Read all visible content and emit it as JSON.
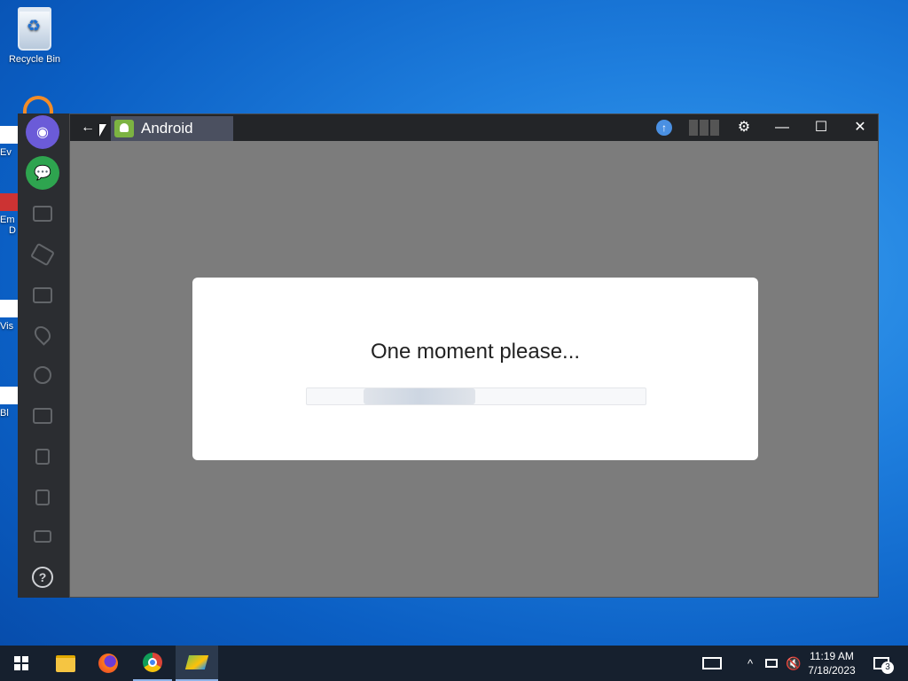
{
  "desktop": {
    "icons": [
      {
        "label": "Recycle Bin"
      },
      {
        "label": "Ev"
      },
      {
        "label": "Em"
      },
      {
        "label": "D"
      },
      {
        "label": "Vis"
      },
      {
        "label": "Bl"
      }
    ]
  },
  "sidebar": {
    "items": [
      {
        "icon": "screen-record-icon"
      },
      {
        "icon": "chat-icon"
      },
      {
        "icon": "multi-instance-icon"
      },
      {
        "icon": "rotate-icon"
      },
      {
        "icon": "screenshot-icon"
      },
      {
        "icon": "location-icon"
      },
      {
        "icon": "apk-icon"
      },
      {
        "icon": "folder-icon"
      },
      {
        "icon": "copy-icon"
      },
      {
        "icon": "paste-icon"
      },
      {
        "icon": "volume-icon"
      },
      {
        "icon": "help-icon",
        "label": "?"
      }
    ]
  },
  "window": {
    "back_label": "←",
    "tab_title": "Android",
    "buttons": {
      "upload": "↑",
      "settings": "⚙",
      "minimize": "—",
      "maximize": "☐",
      "close": "✕"
    }
  },
  "dialog": {
    "message": "One moment please...",
    "progress": 0.33
  },
  "taskbar": {
    "time": "11:19 AM",
    "date": "7/18/2023",
    "notification_count": "3",
    "chevron": "^"
  }
}
